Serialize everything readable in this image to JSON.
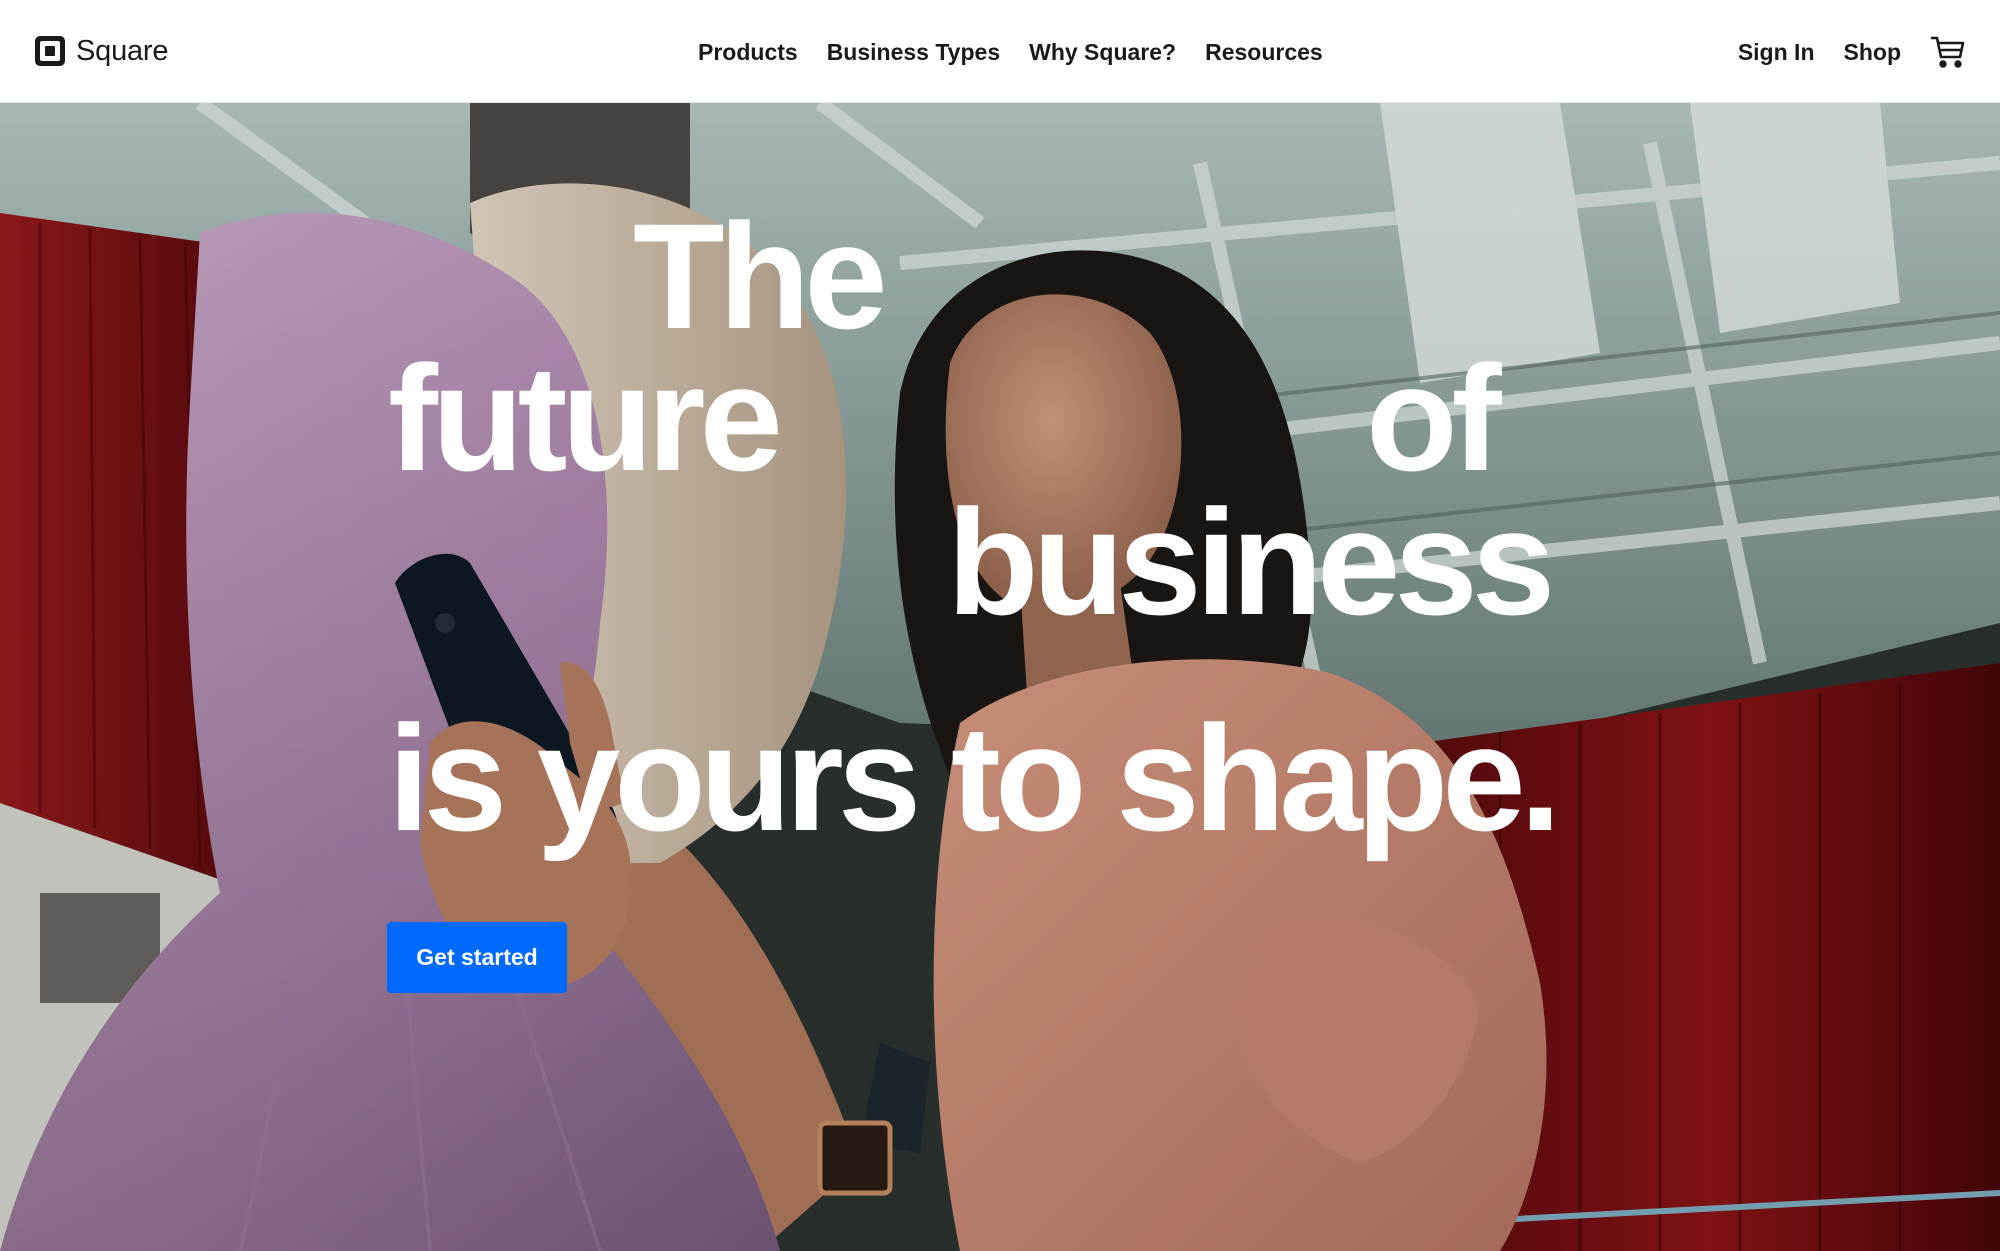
{
  "brand": {
    "name": "Square",
    "logo_icon": "square-logo-icon"
  },
  "nav": {
    "items": [
      {
        "label": "Products"
      },
      {
        "label": "Business Types"
      },
      {
        "label": "Why Square?"
      },
      {
        "label": "Resources"
      }
    ]
  },
  "utility": {
    "sign_in": "Sign In",
    "shop": "Shop",
    "cart_icon": "shopping-cart-icon"
  },
  "hero": {
    "headline_words": [
      "The",
      "future",
      "of",
      "business",
      "is yours to shape."
    ],
    "cta_label": "Get started"
  },
  "colors": {
    "accent": "#006aff",
    "header_bg": "#ffffff",
    "text": "#1a1a1a",
    "headline": "#ffffff"
  }
}
